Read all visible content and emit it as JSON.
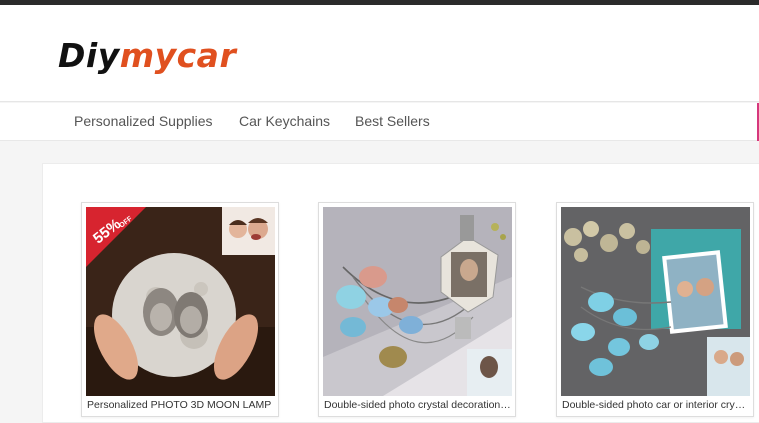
{
  "brand": {
    "name_part1": "Diy",
    "name_part2": "mycar",
    "color_dark": "#111111",
    "color_accent": "#e0501f"
  },
  "nav": {
    "items": [
      {
        "label": "Personalized Supplies"
      },
      {
        "label": "Car Keychains"
      },
      {
        "label": "Best Sellers"
      }
    ],
    "accent_color": "#d6377d"
  },
  "products": [
    {
      "title": "Personalized PHOTO 3D MOON LAMP",
      "badge": {
        "percent": "55",
        "suffix": "OFF",
        "color": "#d7242f"
      }
    },
    {
      "title": "Double-sided photo crystal decoration necklace"
    },
    {
      "title": "Double-sided photo car or interior crystal hanging"
    }
  ]
}
